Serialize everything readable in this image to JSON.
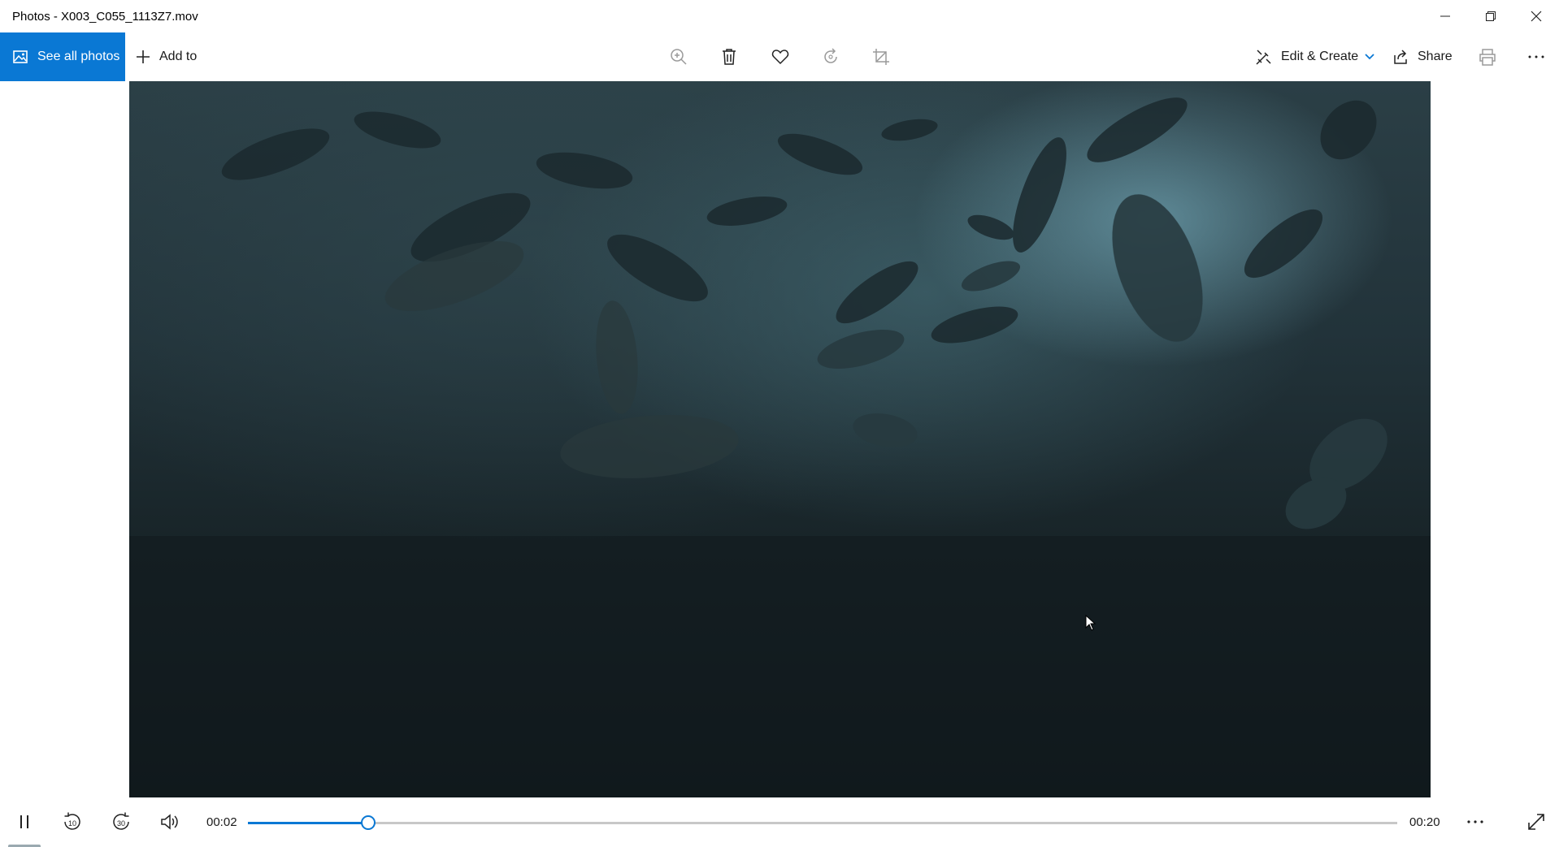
{
  "window": {
    "title": "Photos - X003_C055_1113Z7.mov",
    "minimize_icon": "minimize-icon",
    "restore_icon": "restore-icon",
    "close_icon": "close-icon"
  },
  "toolbar": {
    "see_all_label": "See all photos",
    "add_to_label": "Add to",
    "edit_create_label": "Edit & Create",
    "share_label": "Share",
    "accent": "#0a78d4",
    "icons": [
      "zoom-icon",
      "delete-icon",
      "favorite-icon",
      "rotate-icon",
      "crop-icon",
      "print-icon",
      "more-icon"
    ]
  },
  "player": {
    "current_time": "00:02",
    "total_time": "00:20",
    "progress": 0.105,
    "skip_back_label": "10",
    "skip_forward_label": "30"
  }
}
